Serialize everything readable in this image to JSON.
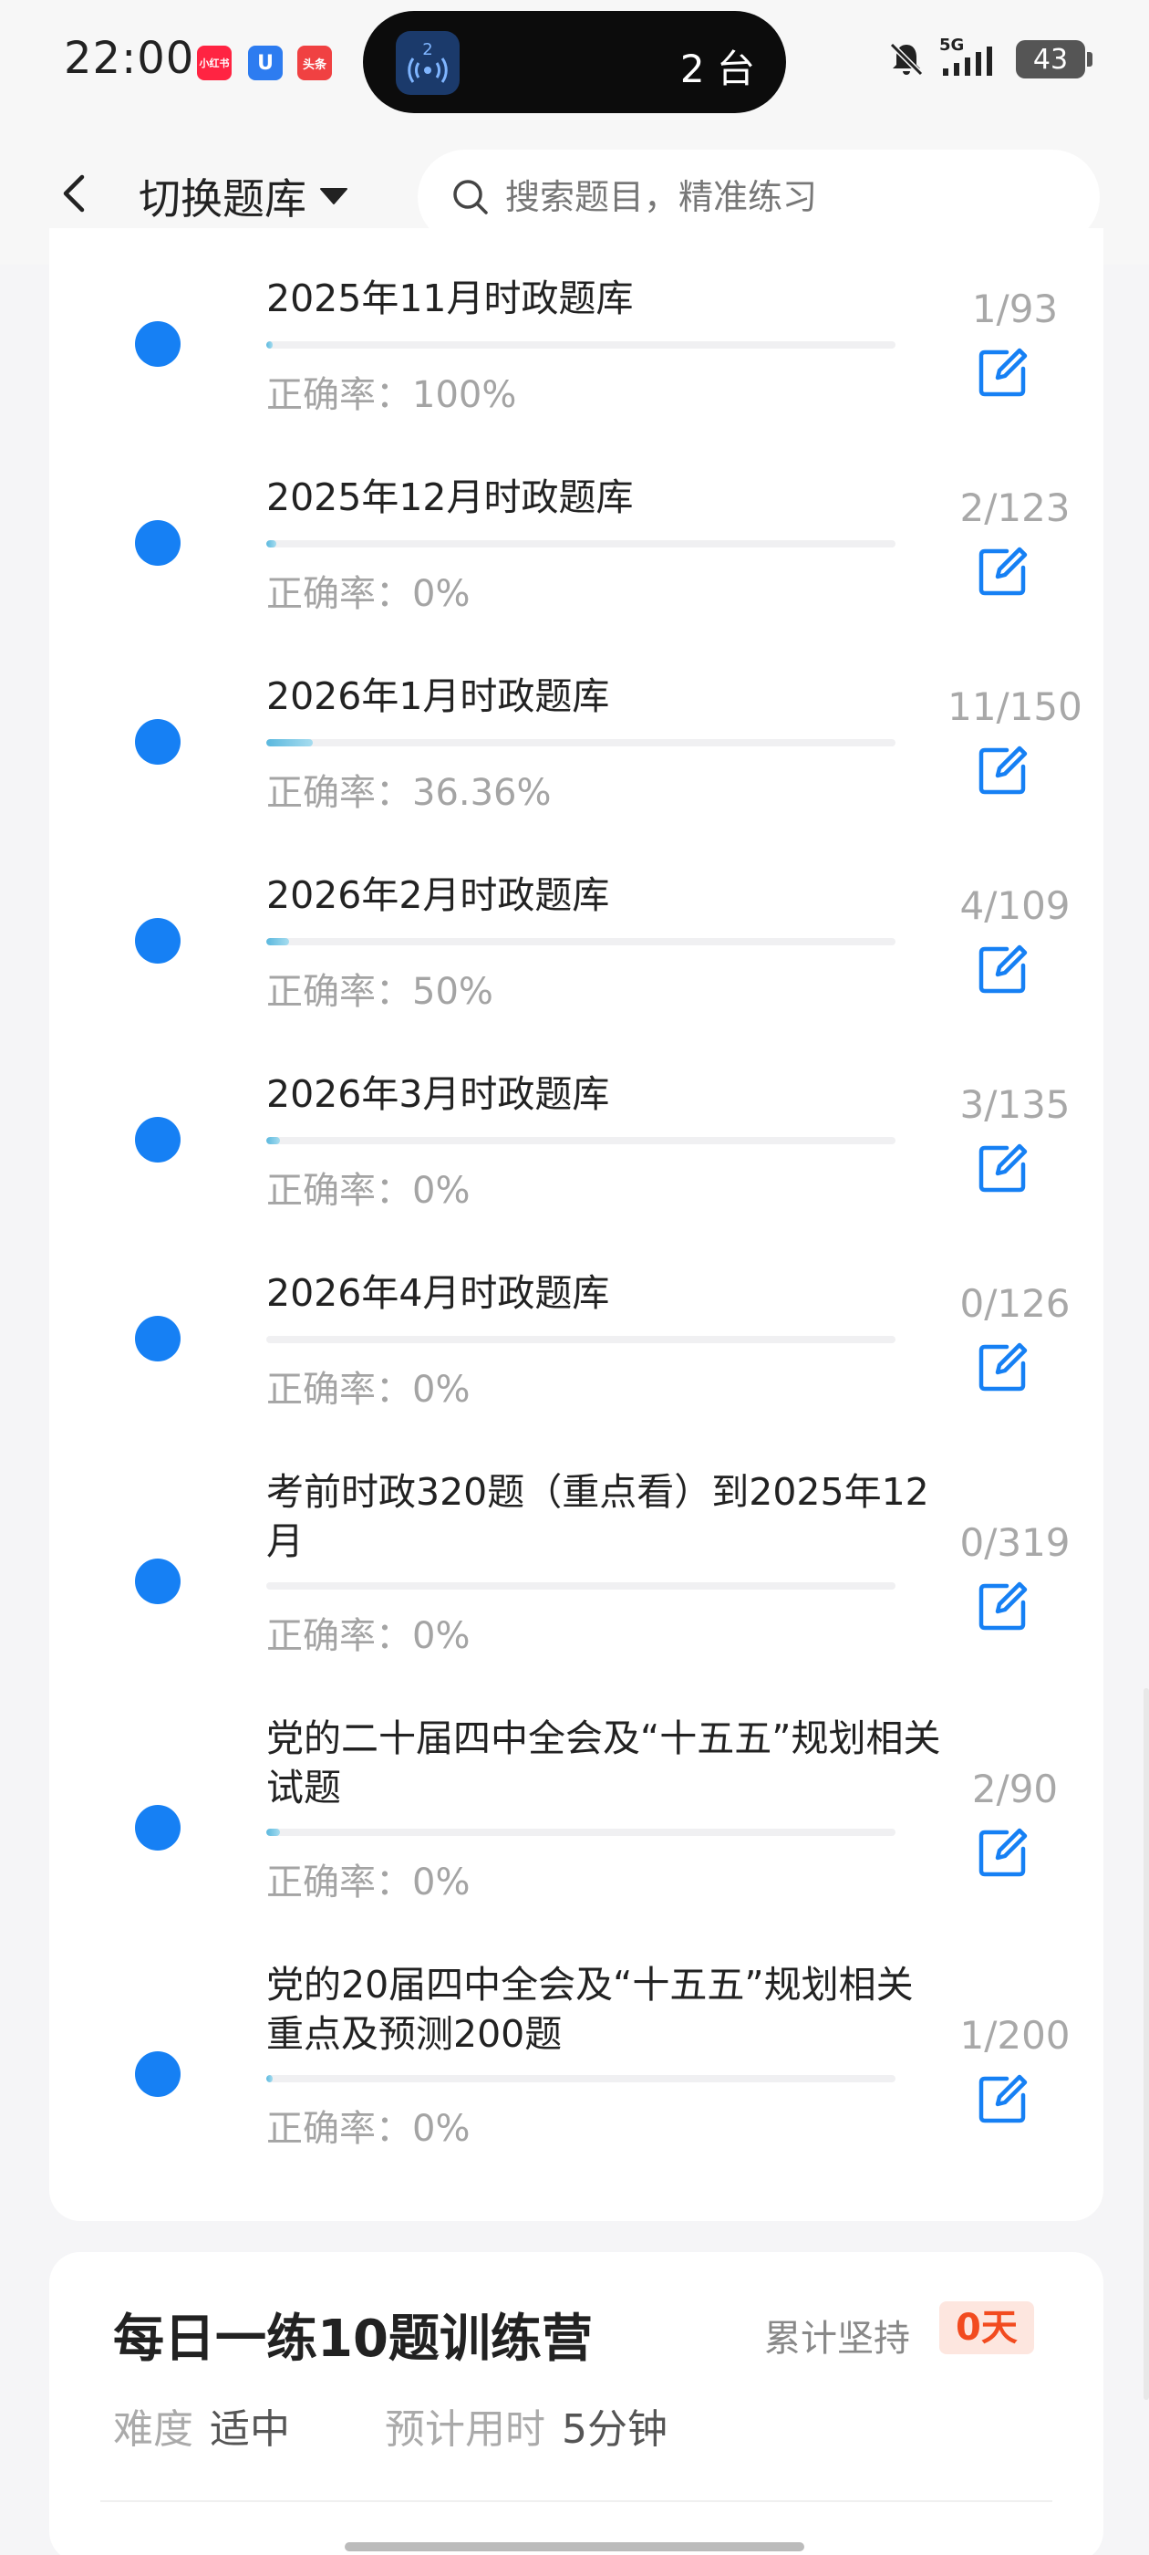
{
  "status_bar": {
    "time": "22:00",
    "notification_apps": [
      {
        "name": "小红书",
        "color": "#ff2442"
      },
      {
        "name": "U",
        "color": "#2d7cf0"
      },
      {
        "name": "头条",
        "color": "#f04142"
      }
    ],
    "island_badge": "2",
    "island_text": "2 台",
    "network": "5G",
    "battery": "43"
  },
  "header": {
    "back_icon": "chevron-left-icon",
    "switch_label": "切换题库",
    "search_placeholder": "搜索题目，精准练习"
  },
  "question_banks": [
    {
      "title": "2025年11月时政题库",
      "accuracy": "正确率：100%",
      "count": "1/93",
      "progress": 0.0108
    },
    {
      "title": "2025年12月时政题库",
      "accuracy": "正确率：0%",
      "count": "2/123",
      "progress": 0.0163
    },
    {
      "title": "2026年1月时政题库",
      "accuracy": "正确率：36.36%",
      "count": "11/150",
      "progress": 0.0733
    },
    {
      "title": "2026年2月时政题库",
      "accuracy": "正确率：50%",
      "count": "4/109",
      "progress": 0.0367
    },
    {
      "title": "2026年3月时政题库",
      "accuracy": "正确率：0%",
      "count": "3/135",
      "progress": 0.0222
    },
    {
      "title": "2026年4月时政题库",
      "accuracy": "正确率：0%",
      "count": "0/126",
      "progress": 0
    },
    {
      "title": "考前时政320题（重点看）到2025年12月",
      "accuracy": "正确率：0%",
      "count": "0/319",
      "progress": 0
    },
    {
      "title": "党的二十届四中全会及“十五五”规划相关试题",
      "accuracy": "正确率：0%",
      "count": "2/90",
      "progress": 0.0222
    },
    {
      "title": "党的20届四中全会及“十五五”规划相关重点及预测200题",
      "accuracy": "正确率：0%",
      "count": "1/200",
      "progress": 0.005
    }
  ],
  "training": {
    "title": "每日一练10题训练营",
    "persist_label": "累计坚持",
    "persist_value": "0天",
    "difficulty_label": "难度",
    "difficulty_value": "适中",
    "time_label": "预计用时",
    "time_value": "5分钟"
  },
  "colors": {
    "dot": "#1680f4",
    "progress": "#5ab8de",
    "badge_text": "#f24b1f",
    "badge_bg": "#fde6df"
  }
}
